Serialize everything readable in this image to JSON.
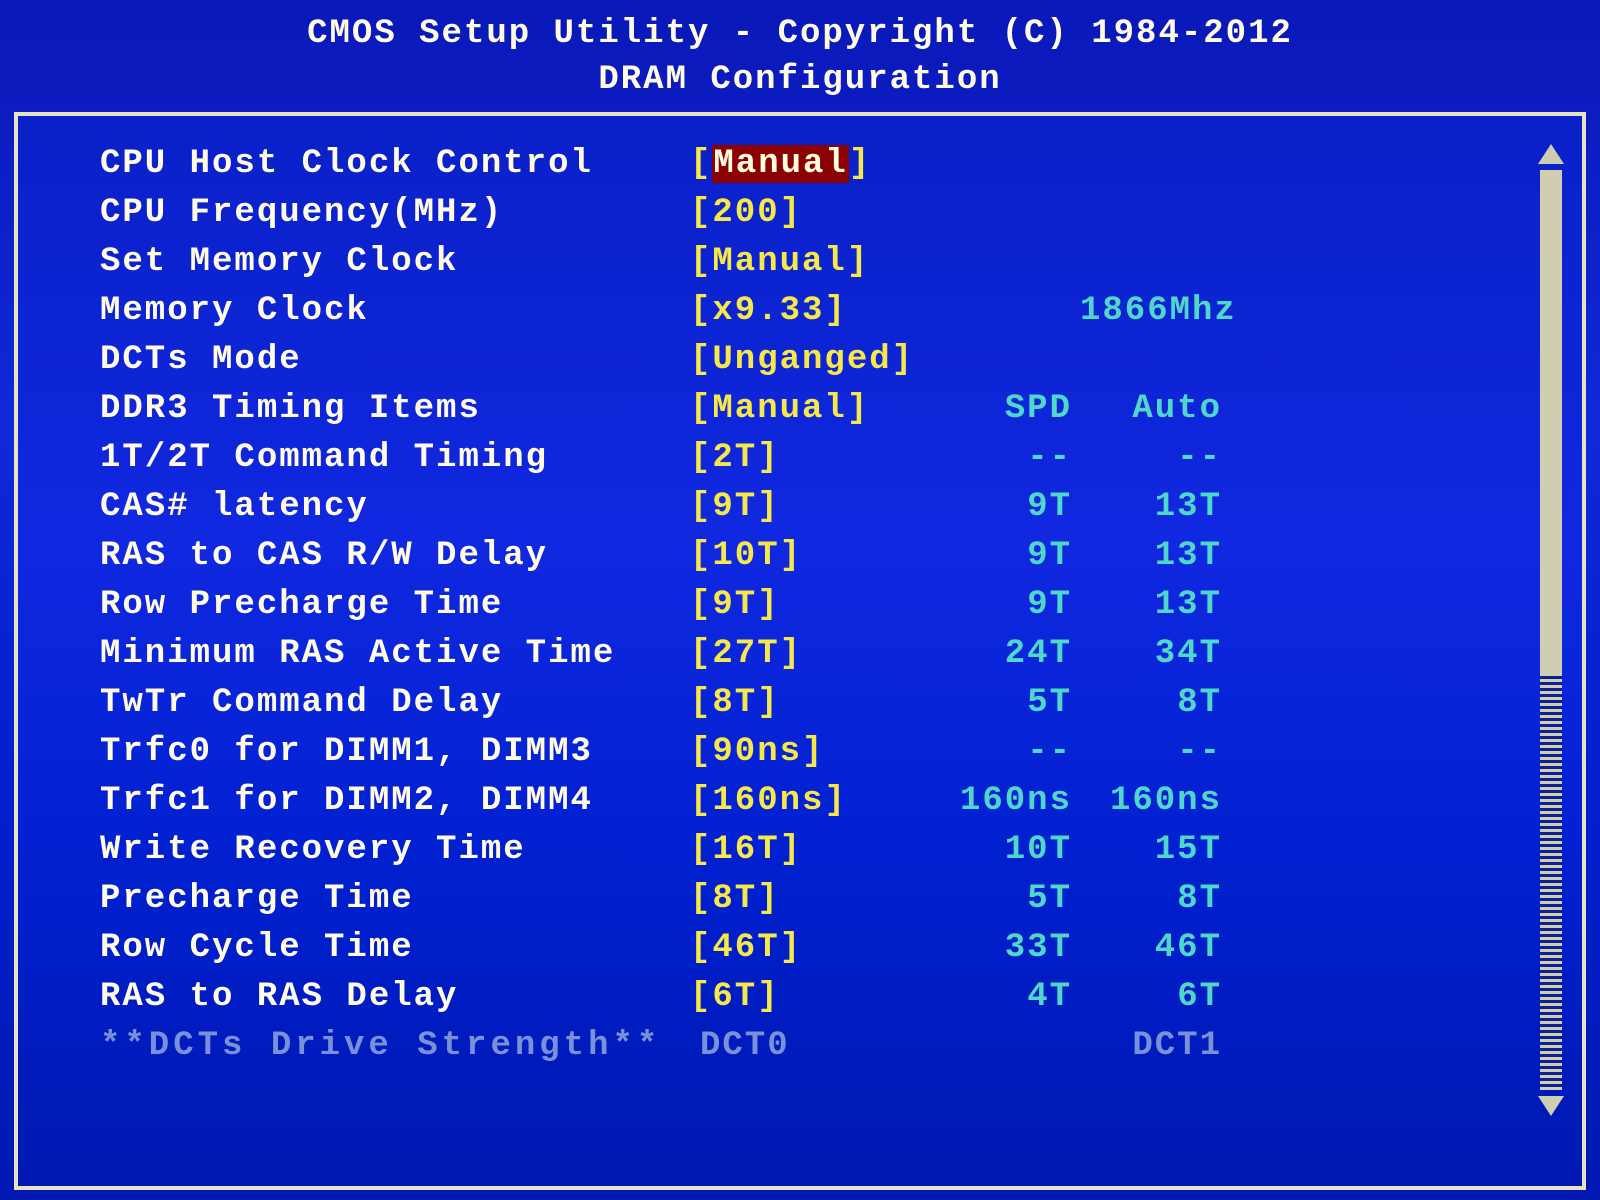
{
  "header": {
    "title": "CMOS Setup Utility - Copyright (C) 1984-2012",
    "subtitle": "DRAM Configuration"
  },
  "columns": {
    "spd": "SPD",
    "auto": "Auto"
  },
  "settings": [
    {
      "label": "CPU Host Clock Control",
      "value": "Manual",
      "selected": true
    },
    {
      "label": "CPU Frequency(MHz)",
      "value": "200"
    },
    {
      "label": "Set Memory Clock",
      "value": "Manual"
    },
    {
      "label": "Memory Clock",
      "value": "x9.33",
      "info_span": "1866Mhz"
    },
    {
      "label": "DCTs Mode",
      "value": "Unganged"
    },
    {
      "label": "DDR3 Timing Items",
      "value": "Manual",
      "header_after": true
    },
    {
      "label": "1T/2T Command Timing",
      "value": "2T",
      "spd": "--",
      "auto": "--"
    },
    {
      "label": "CAS# latency",
      "value": "9T",
      "spd": "9T",
      "auto": "13T"
    },
    {
      "label": "RAS to CAS R/W Delay",
      "value": "10T",
      "spd": "9T",
      "auto": "13T"
    },
    {
      "label": "Row Precharge Time",
      "value": "9T",
      "spd": "9T",
      "auto": "13T"
    },
    {
      "label": "Minimum RAS Active Time",
      "value": "27T",
      "spd": "24T",
      "auto": "34T"
    },
    {
      "label": "TwTr Command Delay",
      "value": "8T",
      "spd": "5T",
      "auto": "8T"
    },
    {
      "label": "Trfc0 for DIMM1, DIMM3",
      "value": "90ns",
      "spd": "--",
      "auto": "--"
    },
    {
      "label": "Trfc1 for DIMM2, DIMM4",
      "value": "160ns",
      "spd": "160ns",
      "auto": "160ns"
    },
    {
      "label": "Write Recovery Time",
      "value": "16T",
      "spd": "10T",
      "auto": "15T"
    },
    {
      "label": "Precharge Time",
      "value": "8T",
      "spd": "5T",
      "auto": "8T"
    },
    {
      "label": "Row Cycle Time",
      "value": "46T",
      "spd": "33T",
      "auto": "46T"
    },
    {
      "label": "RAS to RAS Delay",
      "value": "6T",
      "spd": "4T",
      "auto": "6T"
    }
  ],
  "footer": {
    "label": "**DCTs Drive Strength**",
    "dct0": "DCT0",
    "dct1": "DCT1"
  }
}
